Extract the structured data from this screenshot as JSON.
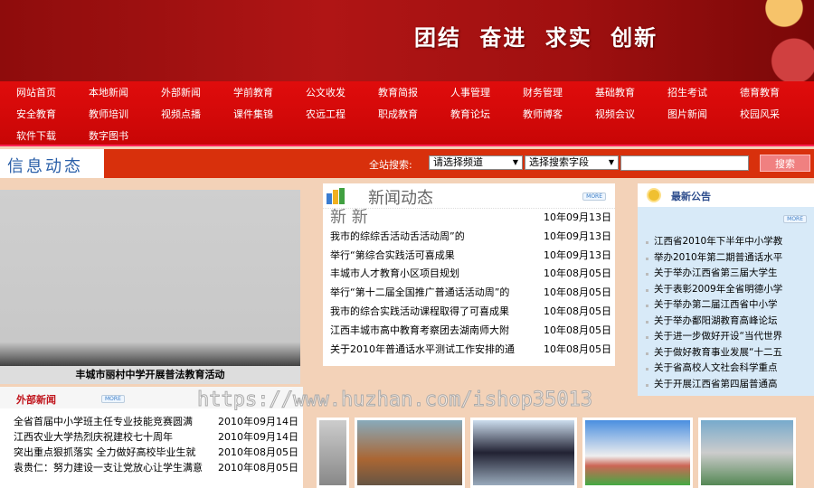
{
  "header": {
    "slogan": "团结 奋进 求实 创新"
  },
  "nav": {
    "rows": [
      [
        "网站首页",
        "本地新闻",
        "外部新闻",
        "学前教育",
        "公文收发",
        "教育简报",
        "人事管理",
        "财务管理",
        "基础教育",
        "招生考试",
        "德育教育"
      ],
      [
        "安全教育",
        "教师培训",
        "视频点播",
        "课件集锦",
        "农远工程",
        "职成教育",
        "教育论坛",
        "教师博客",
        "视频会议",
        "图片新闻",
        "校园风采"
      ],
      [
        "软件下载",
        "数字图书"
      ]
    ]
  },
  "bar": {
    "title": "信息动态",
    "search_label": "全站搜索:",
    "channel_select": "请选择频道",
    "field_select": "选择搜索字段",
    "search_value": "",
    "search_button": "搜索"
  },
  "feature": {
    "caption": "丰城市丽村中学开展普法教育活动"
  },
  "external_news": {
    "title": "外部新闻",
    "more": "MORE",
    "items": [
      {
        "title": "全省首届中小学班主任专业技能竞赛圆满",
        "date": "2010年09月14日"
      },
      {
        "title": "江西农业大学热烈庆祝建校七十周年",
        "date": "2010年09月14日"
      },
      {
        "title": "突出重点狠抓落实 全力做好高校毕业生就",
        "date": "2010年08月05日"
      },
      {
        "title": "袁贵仁：努力建设一支让党放心让学生满意",
        "date": "2010年08月05日"
      }
    ]
  },
  "news": {
    "title": "新闻动态",
    "more": "MORE",
    "items": [
      {
        "title": "新 新",
        "date": "10年09月13日"
      },
      {
        "title": "我市的综综舌活动舌活动周”的",
        "date": "10年09月13日"
      },
      {
        "title": "举行“第综合实践活可喜成果",
        "date": "10年09月13日"
      },
      {
        "title": "丰城市人才教育小区项目规划",
        "date": "10年08月05日"
      },
      {
        "title": "举行“第十二届全国推广普通话活动周”的",
        "date": "10年08月05日"
      },
      {
        "title": "我市的综合实践活动课程取得了可喜成果",
        "date": "10年08月05日"
      },
      {
        "title": "江西丰城市高中教育考察团去湖南师大附",
        "date": "10年08月05日"
      },
      {
        "title": "关于2010年普通话水平测试工作安排的通",
        "date": "10年08月05日"
      }
    ]
  },
  "notices": {
    "title": "最新公告",
    "more": "MORE",
    "items": [
      "江西省2010年下半年中小学教",
      "举办2010年第二期普通话水平",
      "关于举办江西省第三届大学生",
      "关于表彰2009年全省明德小学",
      "关于举办第二届江西省中小学",
      "关于举办鄱阳湖教育高峰论坛",
      "关于进一步做好开设“当代世界",
      "关于做好教育事业发展“十二五",
      "关于省高校人文社会科学重点",
      "关于开展江西省第四届普通高"
    ]
  },
  "watermark": "https://www.huzhan.com/ishop35013"
}
